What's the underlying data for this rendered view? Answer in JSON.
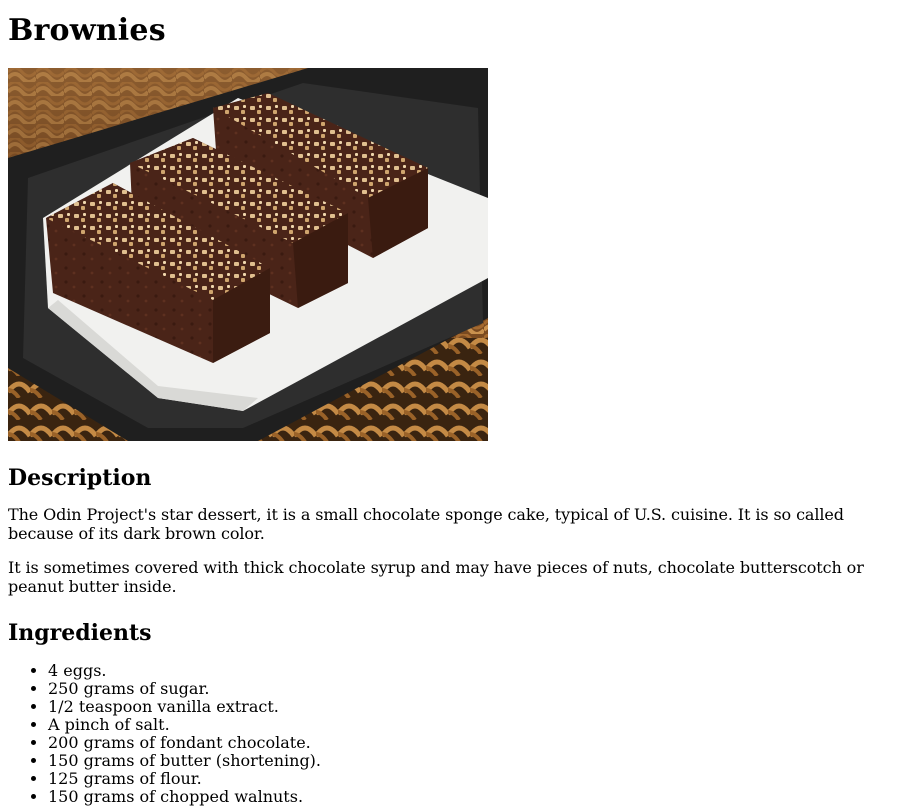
{
  "recipe": {
    "title": "Brownies",
    "photo": {
      "alt": "Brownies",
      "colors": {
        "basket": "#8a5a2c",
        "basket_dark": "#3a2410",
        "plate": "#2a2a2a",
        "napkin": "#f2f2f0",
        "brownie": "#4a2418",
        "nuts": "#d8b482"
      }
    },
    "description": {
      "heading": "Description",
      "paragraphs": [
        "The Odin Project's star dessert, it is a small chocolate sponge cake, typical of U.S. cuisine. It is so called because of its dark brown color.",
        "It is sometimes covered with thick chocolate syrup and may have pieces of nuts, chocolate butterscotch or peanut butter inside."
      ]
    },
    "ingredients": {
      "heading": "Ingredients",
      "items": [
        "4 eggs.",
        "250 grams of sugar.",
        "1/2 teaspoon vanilla extract.",
        "A pinch of salt.",
        "200 grams of fondant chocolate.",
        "150 grams of butter (shortening).",
        "125 grams of flour.",
        "150 grams of chopped walnuts."
      ]
    }
  }
}
